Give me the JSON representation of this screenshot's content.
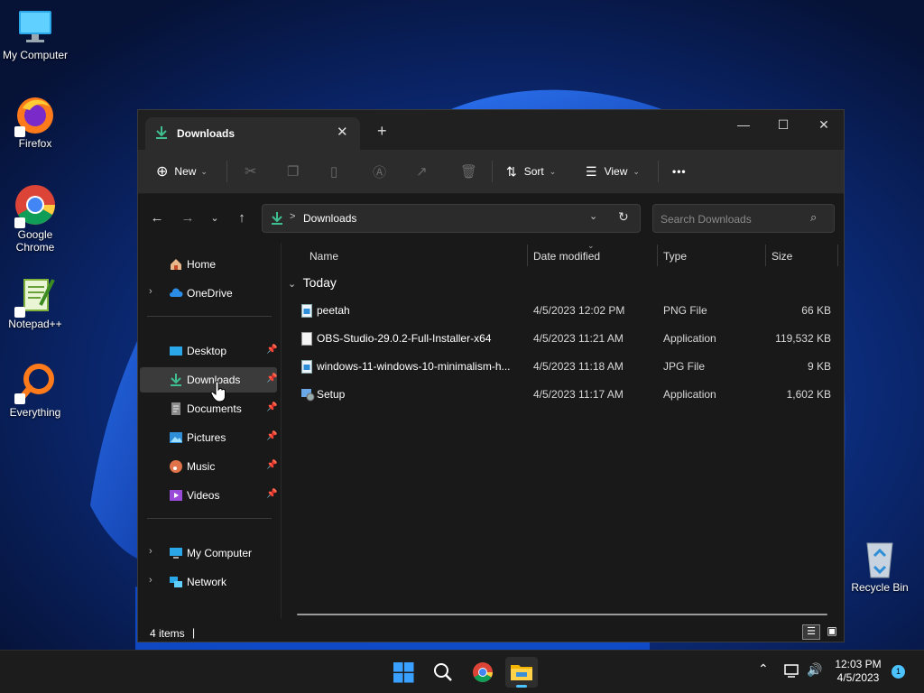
{
  "desktop": {
    "icons": [
      {
        "label": "My Computer"
      },
      {
        "label": "Firefox"
      },
      {
        "label": "Google Chrome"
      },
      {
        "label": "Notepad++"
      },
      {
        "label": "Everything"
      },
      {
        "label": "Recycle Bin"
      }
    ]
  },
  "window": {
    "tab_title": "Downloads",
    "new_tab_symbol": "+",
    "toolbar": {
      "new_label": "New",
      "sort_label": "Sort",
      "view_label": "View",
      "more_label": "•••"
    },
    "address": {
      "path": "Downloads",
      "separator": ">"
    },
    "search": {
      "placeholder": "Search Downloads"
    },
    "nav_pane": {
      "top": [
        {
          "label": "Home",
          "icon": "home-icon"
        },
        {
          "label": "OneDrive",
          "icon": "cloud-icon"
        }
      ],
      "quick_access": [
        {
          "label": "Desktop",
          "icon": "desktop-icon",
          "pinned": true
        },
        {
          "label": "Downloads",
          "icon": "download-icon",
          "pinned": true,
          "selected": true
        },
        {
          "label": "Documents",
          "icon": "document-icon",
          "pinned": true
        },
        {
          "label": "Pictures",
          "icon": "pictures-icon",
          "pinned": true
        },
        {
          "label": "Music",
          "icon": "music-icon",
          "pinned": true
        },
        {
          "label": "Videos",
          "icon": "videos-icon",
          "pinned": true
        }
      ],
      "bottom": [
        {
          "label": "My Computer",
          "icon": "computer-icon"
        },
        {
          "label": "Network",
          "icon": "network-icon"
        }
      ]
    },
    "columns": {
      "name": "Name",
      "date": "Date modified",
      "type": "Type",
      "size": "Size"
    },
    "group": "Today",
    "files": [
      {
        "name": "peetah",
        "date": "4/5/2023 12:02 PM",
        "type": "PNG File",
        "size": "66 KB",
        "icon": "image-file-icon"
      },
      {
        "name": "OBS-Studio-29.0.2-Full-Installer-x64",
        "date": "4/5/2023 11:21 AM",
        "type": "Application",
        "size": "119,532 KB",
        "icon": "blank-file-icon"
      },
      {
        "name": "windows-11-windows-10-minimalism-h...",
        "date": "4/5/2023 11:18 AM",
        "type": "JPG File",
        "size": "9 KB",
        "icon": "image-file-icon"
      },
      {
        "name": "Setup",
        "date": "4/5/2023 11:17 AM",
        "type": "Application",
        "size": "1,602 KB",
        "icon": "setup-icon"
      }
    ],
    "status": {
      "items": "4 items",
      "cursor": "|"
    }
  },
  "taskbar": {
    "time": "12:03 PM",
    "date": "4/5/2023",
    "notifications": "1"
  },
  "colors": {
    "accent_download": "#3fbf8f",
    "selected_bg": "#3b3b3b",
    "window_bg": "#191919",
    "taskbar_bg": "#1c1c1c",
    "notification_badge": "#4cc2ff"
  }
}
